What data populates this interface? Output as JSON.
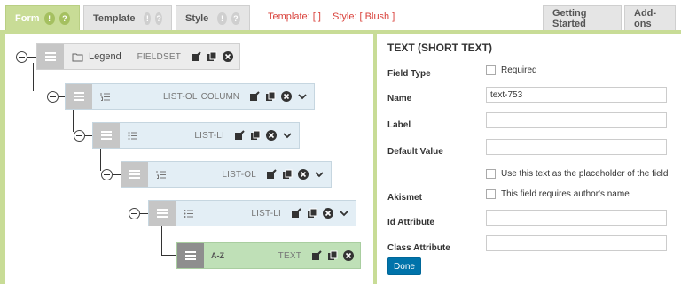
{
  "tabs": {
    "form": {
      "label": "Form",
      "badge1": "!",
      "badge2": "?"
    },
    "template": {
      "label": "Template",
      "badge1": "!",
      "badge2": "?"
    },
    "style": {
      "label": "Style",
      "badge1": "!",
      "badge2": "?"
    },
    "getting_started": {
      "label": "Getting Started"
    },
    "addons": {
      "label": "Add-ons"
    }
  },
  "template_info": {
    "template": "Template: [ ]",
    "style": "Style: [ Blush ]"
  },
  "tree": {
    "fieldset": {
      "label": "Legend",
      "type": "FIELDSET"
    },
    "list_ol_column": {
      "type": "LIST-OL",
      "type2": "COLUMN"
    },
    "list_li_1": {
      "type": "LIST-LI"
    },
    "list_ol": {
      "type": "LIST-OL"
    },
    "list_li_2": {
      "type": "LIST-LI"
    },
    "text": {
      "label": "A-Z",
      "type": "TEXT"
    }
  },
  "panel": {
    "title": "TEXT (SHORT TEXT)",
    "field_type_label": "Field Type",
    "required_label": "Required",
    "name_label": "Name",
    "name_value": "text-753",
    "label_label": "Label",
    "label_value": "",
    "default_label": "Default Value",
    "default_value": "",
    "placeholder_label": "Use this text as the placeholder of the field",
    "akismet_label": "Akismet",
    "akismet_option": "This field requires author's name",
    "id_label": "Id Attribute",
    "id_value": "",
    "class_label": "Class Attribute",
    "class_value": "",
    "done_label": "Done"
  },
  "colors": {
    "accent_green": "#c8dc96",
    "template_red": "#d9403a",
    "done_blue": "#0073aa"
  }
}
